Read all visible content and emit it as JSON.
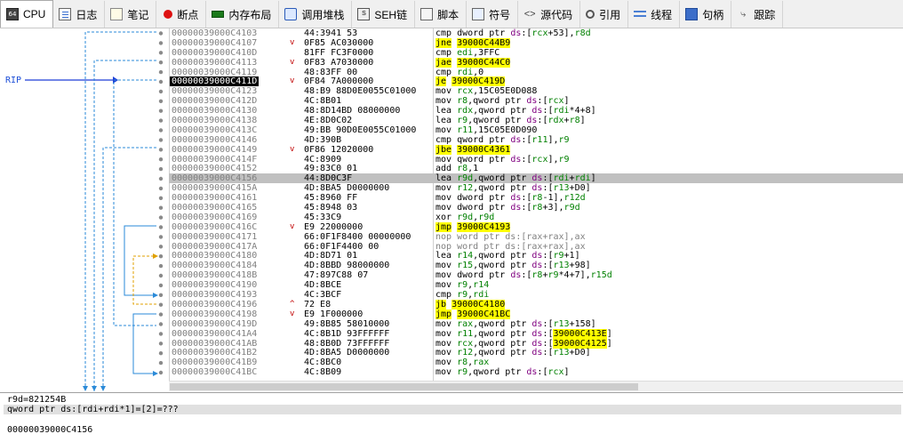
{
  "tabs": [
    {
      "name": "tab-cpu",
      "label": "CPU",
      "icon": "cpu-icon",
      "active": true
    },
    {
      "name": "tab-log",
      "label": "日志",
      "icon": "log-icon"
    },
    {
      "name": "tab-notes",
      "label": "笔记",
      "icon": "notes-icon"
    },
    {
      "name": "tab-breakpoints",
      "label": "断点",
      "icon": "breakpoint-icon"
    },
    {
      "name": "tab-memory-map",
      "label": "内存布局",
      "icon": "memory-icon"
    },
    {
      "name": "tab-call-stack",
      "label": "调用堆栈",
      "icon": "call-stack-icon"
    },
    {
      "name": "tab-seh",
      "label": "SEH链",
      "icon": "seh-icon"
    },
    {
      "name": "tab-script",
      "label": "脚本",
      "icon": "script-icon"
    },
    {
      "name": "tab-symbols",
      "label": "符号",
      "icon": "symbols-icon"
    },
    {
      "name": "tab-source",
      "label": "源代码",
      "icon": "source-icon"
    },
    {
      "name": "tab-references",
      "label": "引用",
      "icon": "references-icon"
    },
    {
      "name": "tab-threads",
      "label": "线程",
      "icon": "threads-icon"
    },
    {
      "name": "tab-handles",
      "label": "句柄",
      "icon": "handles-icon"
    },
    {
      "name": "tab-trace",
      "label": "跟踪",
      "icon": "trace-icon"
    }
  ],
  "rip_label": "RIP",
  "rows": [
    {
      "addr": "00000039000C4103",
      "mark": "",
      "bytes": "44:3941 53",
      "mn": "cmp",
      "ops": [
        [
          "dword ptr ",
          ""
        ],
        [
          "ds",
          ":seg"
        ],
        [
          ":[",
          ""
        ],
        [
          "rcx",
          ":reg"
        ],
        [
          "+53],",
          ""
        ],
        [
          "r8d",
          ":reg"
        ]
      ]
    },
    {
      "addr": "00000039000C4107",
      "mark": "v",
      "bytes": "0F85 AC030000",
      "mn": "jne",
      "jmp": true,
      "target": "39000C44B9"
    },
    {
      "addr": "00000039000C410D",
      "mark": "",
      "bytes": "81FF FC3F0000",
      "mn": "cmp",
      "ops": [
        [
          "edi",
          ":reg"
        ],
        [
          ",3FFC",
          ""
        ]
      ]
    },
    {
      "addr": "00000039000C4113",
      "mark": "v",
      "bytes": "0F83 A7030000",
      "mn": "jae",
      "jmp": true,
      "target": "39000C44C0"
    },
    {
      "addr": "00000039000C4119",
      "mark": "",
      "bytes": "48:83FF 00",
      "mn": "cmp",
      "ops": [
        [
          "rdi",
          ":reg"
        ],
        [
          ",0",
          ""
        ]
      ]
    },
    {
      "addr": "00000039000C411D",
      "mark": "v",
      "bytes": "0F84 7A000000",
      "mn": "je",
      "jmp": true,
      "target": "39000C419D",
      "rip": true
    },
    {
      "addr": "00000039000C4123",
      "mark": "",
      "bytes": "48:B9 88D0E0055C01000",
      "mn": "mov",
      "ops": [
        [
          "rcx",
          ":reg"
        ],
        [
          ",15C05E0D088",
          ""
        ]
      ]
    },
    {
      "addr": "00000039000C412D",
      "mark": "",
      "bytes": "4C:8B01",
      "mn": "mov",
      "ops": [
        [
          "r8",
          ":reg"
        ],
        [
          ",qword ptr ",
          ""
        ],
        [
          "ds",
          ":seg"
        ],
        [
          ":[",
          ""
        ],
        [
          "rcx",
          ":reg"
        ],
        [
          "]",
          ""
        ]
      ]
    },
    {
      "addr": "00000039000C4130",
      "mark": "",
      "bytes": "48:8D14BD 08000000",
      "mn": "lea",
      "ops": [
        [
          "rdx",
          ":reg"
        ],
        [
          ",qword ptr ",
          ""
        ],
        [
          "ds",
          ":seg"
        ],
        [
          ":[",
          ""
        ],
        [
          "rdi",
          ":reg"
        ],
        [
          "*4+8]",
          ""
        ]
      ]
    },
    {
      "addr": "00000039000C4138",
      "mark": "",
      "bytes": "4E:8D0C02",
      "mn": "lea",
      "ops": [
        [
          "r9",
          ":reg"
        ],
        [
          ",qword ptr ",
          ""
        ],
        [
          "ds",
          ":seg"
        ],
        [
          ":[",
          ""
        ],
        [
          "rdx",
          ":reg"
        ],
        [
          "+",
          ""
        ],
        [
          "r8",
          ":reg"
        ],
        [
          "]",
          ""
        ]
      ]
    },
    {
      "addr": "00000039000C413C",
      "mark": "",
      "bytes": "49:BB 90D0E0055C01000",
      "mn": "mov",
      "ops": [
        [
          "r11",
          ":reg"
        ],
        [
          ",15C05E0D090",
          ""
        ]
      ]
    },
    {
      "addr": "00000039000C4146",
      "mark": "",
      "bytes": "4D:390B",
      "mn": "cmp",
      "ops": [
        [
          "qword ptr ",
          ""
        ],
        [
          "ds",
          ":seg"
        ],
        [
          ":[",
          ""
        ],
        [
          "r11",
          ":reg"
        ],
        [
          "],",
          ""
        ],
        [
          "r9",
          ":reg"
        ]
      ]
    },
    {
      "addr": "00000039000C4149",
      "mark": "v",
      "bytes": "0F86 12020000",
      "mn": "jbe",
      "jmp": true,
      "target": "39000C4361"
    },
    {
      "addr": "00000039000C414F",
      "mark": "",
      "bytes": "4C:8909",
      "mn": "mov",
      "ops": [
        [
          "qword ptr ",
          ""
        ],
        [
          "ds",
          ":seg"
        ],
        [
          ":[",
          ""
        ],
        [
          "rcx",
          ":reg"
        ],
        [
          "],",
          ""
        ],
        [
          "r9",
          ":reg"
        ]
      ]
    },
    {
      "addr": "00000039000C4152",
      "mark": "",
      "bytes": "49:83C0 01",
      "mn": "add",
      "ops": [
        [
          "r8",
          ":reg"
        ],
        [
          ",1",
          ""
        ]
      ]
    },
    {
      "addr": "00000039000C4156",
      "mark": "",
      "bytes": "44:8D0C3F",
      "mn": "lea",
      "hl": true,
      "ops": [
        [
          "r9d",
          ":reg"
        ],
        [
          ",qword ptr ",
          ""
        ],
        [
          "ds",
          ":seg"
        ],
        [
          ":[",
          ""
        ],
        [
          "rdi",
          ":reg"
        ],
        [
          "+",
          ""
        ],
        [
          "rdi",
          ":reg"
        ],
        [
          "]",
          ""
        ]
      ]
    },
    {
      "addr": "00000039000C415A",
      "mark": "",
      "bytes": "4D:8BA5 D0000000",
      "mn": "mov",
      "ops": [
        [
          "r12",
          ":reg"
        ],
        [
          ",qword ptr ",
          ""
        ],
        [
          "ds",
          ":seg"
        ],
        [
          ":[",
          ""
        ],
        [
          "r13",
          ":reg"
        ],
        [
          "+D0]",
          ""
        ]
      ]
    },
    {
      "addr": "00000039000C4161",
      "mark": "",
      "bytes": "45:8960 FF",
      "mn": "mov",
      "ops": [
        [
          "dword ptr ",
          ""
        ],
        [
          "ds",
          ":seg"
        ],
        [
          ":[",
          ""
        ],
        [
          "r8",
          ":reg"
        ],
        [
          "-1],",
          ""
        ],
        [
          "r12d",
          ":reg"
        ]
      ]
    },
    {
      "addr": "00000039000C4165",
      "mark": "",
      "bytes": "45:8948 03",
      "mn": "mov",
      "ops": [
        [
          "dword ptr ",
          ""
        ],
        [
          "ds",
          ":seg"
        ],
        [
          ":[",
          ""
        ],
        [
          "r8",
          ":reg"
        ],
        [
          "+3],",
          ""
        ],
        [
          "r9d",
          ":reg"
        ]
      ]
    },
    {
      "addr": "00000039000C4169",
      "mark": "",
      "bytes": "45:33C9",
      "mn": "xor",
      "ops": [
        [
          "r9d",
          ":reg"
        ],
        [
          ",",
          ""
        ],
        [
          "r9d",
          ":reg"
        ]
      ]
    },
    {
      "addr": "00000039000C416C",
      "mark": "v",
      "bytes": "E9 22000000",
      "mn": "jmp",
      "jmp": true,
      "target": "39000C4193"
    },
    {
      "addr": "00000039000C4171",
      "mark": "",
      "bytes": "66:0F1F8400 00000000",
      "mn": "nop",
      "nop": true,
      "ops": [
        [
          "word ptr ds:[rax+rax],ax",
          ""
        ]
      ]
    },
    {
      "addr": "00000039000C417A",
      "mark": "",
      "bytes": "66:0F1F4400 00",
      "mn": "nop",
      "nop": true,
      "ops": [
        [
          "word ptr ds:[rax+rax],ax",
          ""
        ]
      ]
    },
    {
      "addr": "00000039000C4180",
      "mark": "",
      "bytes": "4D:8D71 01",
      "mn": "lea",
      "ops": [
        [
          "r14",
          ":reg"
        ],
        [
          ",qword ptr ",
          ""
        ],
        [
          "ds",
          ":seg"
        ],
        [
          ":[",
          ""
        ],
        [
          "r9",
          ":reg"
        ],
        [
          "+1]",
          ""
        ]
      ]
    },
    {
      "addr": "00000039000C4184",
      "mark": "",
      "bytes": "4D:8BBD 98000000",
      "mn": "mov",
      "ops": [
        [
          "r15",
          ":reg"
        ],
        [
          ",qword ptr ",
          ""
        ],
        [
          "ds",
          ":seg"
        ],
        [
          ":[",
          ""
        ],
        [
          "r13",
          ":reg"
        ],
        [
          "+98]",
          ""
        ]
      ]
    },
    {
      "addr": "00000039000C418B",
      "mark": "",
      "bytes": "47:897C88 07",
      "mn": "mov",
      "ops": [
        [
          "dword ptr ",
          ""
        ],
        [
          "ds",
          ":seg"
        ],
        [
          ":[",
          ""
        ],
        [
          "r8",
          ":reg"
        ],
        [
          "+",
          ""
        ],
        [
          "r9",
          ":reg"
        ],
        [
          "*4+7],",
          ""
        ],
        [
          "r15d",
          ":reg"
        ]
      ]
    },
    {
      "addr": "00000039000C4190",
      "mark": "",
      "bytes": "4D:8BCE",
      "mn": "mov",
      "ops": [
        [
          "r9",
          ":reg"
        ],
        [
          ",",
          ""
        ],
        [
          "r14",
          ":reg"
        ]
      ]
    },
    {
      "addr": "00000039000C4193",
      "mark": "",
      "bytes": "4C:3BCF",
      "mn": "cmp",
      "ops": [
        [
          "r9",
          ":reg"
        ],
        [
          ",",
          ""
        ],
        [
          "rdi",
          ":reg"
        ]
      ]
    },
    {
      "addr": "00000039000C4196",
      "mark": "^",
      "bytes": "72 E8",
      "mn": "jb",
      "jmp": true,
      "target": "39000C4180"
    },
    {
      "addr": "00000039000C4198",
      "mark": "v",
      "bytes": "E9 1F000000",
      "mn": "jmp",
      "jmp": true,
      "target": "39000C41BC"
    },
    {
      "addr": "00000039000C419D",
      "mark": "",
      "bytes": "49:8B85 58010000",
      "mn": "mov",
      "ops": [
        [
          "rax",
          ":reg"
        ],
        [
          ",qword ptr ",
          ""
        ],
        [
          "ds",
          ":seg"
        ],
        [
          ":[",
          ""
        ],
        [
          "r13",
          ":reg"
        ],
        [
          "+158]",
          ""
        ]
      ]
    },
    {
      "addr": "00000039000C41A4",
      "mark": "",
      "bytes": "4C:8B1D 93FFFFFF",
      "mn": "mov",
      "ops": [
        [
          "r11",
          ":reg"
        ],
        [
          ",qword ptr ",
          ""
        ],
        [
          "ds",
          ":seg"
        ],
        [
          ":[",
          ""
        ],
        [
          "39000C413E",
          ":jt"
        ],
        [
          "]",
          ""
        ]
      ]
    },
    {
      "addr": "00000039000C41AB",
      "mark": "",
      "bytes": "48:8B0D 73FFFFFF",
      "mn": "mov",
      "ops": [
        [
          "rcx",
          ":reg"
        ],
        [
          ",qword ptr ",
          ""
        ],
        [
          "ds",
          ":seg"
        ],
        [
          ":[",
          ""
        ],
        [
          "39000C4125",
          ":jt"
        ],
        [
          "]",
          ""
        ]
      ]
    },
    {
      "addr": "00000039000C41B2",
      "mark": "",
      "bytes": "4D:8BA5 D0000000",
      "mn": "mov",
      "ops": [
        [
          "r12",
          ":reg"
        ],
        [
          ",qword ptr ",
          ""
        ],
        [
          "ds",
          ":seg"
        ],
        [
          ":[",
          ""
        ],
        [
          "r13",
          ":reg"
        ],
        [
          "+D0]",
          ""
        ]
      ]
    },
    {
      "addr": "00000039000C41B9",
      "mark": "",
      "bytes": "4C:8BC0",
      "mn": "mov",
      "ops": [
        [
          "r8",
          ":reg"
        ],
        [
          ",",
          ""
        ],
        [
          "rax",
          ":reg"
        ]
      ]
    },
    {
      "addr": "00000039000C41BC",
      "mark": "",
      "bytes": "4C:8B09",
      "mn": "mov",
      "ops": [
        [
          "r9",
          ":reg"
        ],
        [
          ",qword ptr ",
          ""
        ],
        [
          "ds",
          ":seg"
        ],
        [
          ":[",
          ""
        ],
        [
          "rcx",
          ":reg"
        ],
        [
          "]",
          ""
        ]
      ]
    }
  ],
  "info": {
    "line1": "r9d=821254B",
    "line2": "qword ptr ds:[rdi+rdi*1]=[2]=???",
    "line3": "00000039000C4156"
  }
}
